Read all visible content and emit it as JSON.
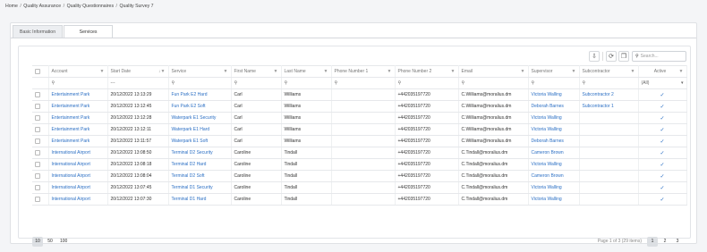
{
  "breadcrumb": [
    "Home",
    "Quality Assurance",
    "Quality Questionnaires",
    "Quality Survey 7"
  ],
  "tabs": [
    "Basic Information",
    "Services"
  ],
  "toolbar": {
    "search_placeholder": "Search..."
  },
  "columns": [
    "Account",
    "Start Date",
    "Service",
    "First Name",
    "Last Name",
    "Phone Number 1",
    "Phone Number 2",
    "Email",
    "Supervisor",
    "Subcontractor",
    "Active"
  ],
  "filters": {
    "start_date": "---",
    "active": "(All)"
  },
  "rows": [
    {
      "account": "Entertainment Park",
      "start_date": "20/12/2022 13:13:29",
      "service": "Fun Park E2 Hard",
      "first": "Carl",
      "last": "Williams",
      "phone1": "",
      "phone2": "+442035197720",
      "email": "C.Williams@moralius.dm",
      "supervisor": "Victoria Walling",
      "subcontractor": "Subcontractor 2",
      "active": "✓"
    },
    {
      "account": "Entertainment Park",
      "start_date": "20/12/2022 13:12:45",
      "service": "Fun Park E2 Soft",
      "first": "Carl",
      "last": "Williams",
      "phone1": "",
      "phone2": "+442035197720",
      "email": "C.Williams@moralius.dm",
      "supervisor": "Deborah Barnes",
      "subcontractor": "Subcontractor 1",
      "active": "✓"
    },
    {
      "account": "Entertainment Park",
      "start_date": "20/12/2022 13:12:28",
      "service": "Waterpark E1 Security",
      "first": "Carl",
      "last": "Williams",
      "phone1": "",
      "phone2": "+442035197720",
      "email": "C.Williams@moralius.dm",
      "supervisor": "Victoria Walling",
      "subcontractor": "",
      "active": "✓"
    },
    {
      "account": "Entertainment Park",
      "start_date": "20/12/2022 13:12:11",
      "service": "Waterpark E1 Hard",
      "first": "Carl",
      "last": "Williams",
      "phone1": "",
      "phone2": "+442035197720",
      "email": "C.Williams@moralius.dm",
      "supervisor": "Victoria Walling",
      "subcontractor": "",
      "active": "✓"
    },
    {
      "account": "Entertainment Park",
      "start_date": "20/12/2022 13:11:57",
      "service": "Waterpark E1 Soft",
      "first": "Carl",
      "last": "Williams",
      "phone1": "",
      "phone2": "+442035197720",
      "email": "C.Williams@moralius.dm",
      "supervisor": "Deborah Barnes",
      "subcontractor": "",
      "active": "✓"
    },
    {
      "account": "International Airport",
      "start_date": "20/12/2022 13:08:50",
      "service": "Terminal D2 Security",
      "first": "Caroline",
      "last": "Tindall",
      "phone1": "",
      "phone2": "+442035197720",
      "email": "C.Tindall@moralius.dm",
      "supervisor": "Cameron Brown",
      "subcontractor": "",
      "active": "✓"
    },
    {
      "account": "International Airport",
      "start_date": "20/12/2022 13:08:18",
      "service": "Terminal D2 Hard",
      "first": "Caroline",
      "last": "Tindall",
      "phone1": "",
      "phone2": "+442035197720",
      "email": "C.Tindall@moralius.dm",
      "supervisor": "Victoria Walling",
      "subcontractor": "",
      "active": "✓"
    },
    {
      "account": "International Airport",
      "start_date": "20/12/2022 13:08:04",
      "service": "Terminal D2 Soft",
      "first": "Caroline",
      "last": "Tindall",
      "phone1": "",
      "phone2": "+442035197720",
      "email": "C.Tindall@moralius.dm",
      "supervisor": "Cameron Brown",
      "subcontractor": "",
      "active": "✓"
    },
    {
      "account": "International Airport",
      "start_date": "20/12/2022 13:07:45",
      "service": "Terminal D1 Security",
      "first": "Caroline",
      "last": "Tindall",
      "phone1": "",
      "phone2": "+442035197720",
      "email": "C.Tindall@moralius.dm",
      "supervisor": "Victoria Walling",
      "subcontractor": "",
      "active": "✓"
    },
    {
      "account": "International Airport",
      "start_date": "20/12/2022 13:07:30",
      "service": "Terminal D1 Hard",
      "first": "Caroline",
      "last": "Tindall",
      "phone1": "",
      "phone2": "+442035197720",
      "email": "C.Tindall@moralius.dm",
      "supervisor": "Victoria Walling",
      "subcontractor": "",
      "active": "✓"
    }
  ],
  "pager": {
    "sizes": [
      "10",
      "50",
      "100"
    ],
    "info": "Page 1 of 3 (29 items)",
    "pages": [
      "1",
      "2",
      "3"
    ]
  },
  "colors": {
    "link": "#2b6fc4",
    "selected_bg": "#dcdfe3"
  }
}
